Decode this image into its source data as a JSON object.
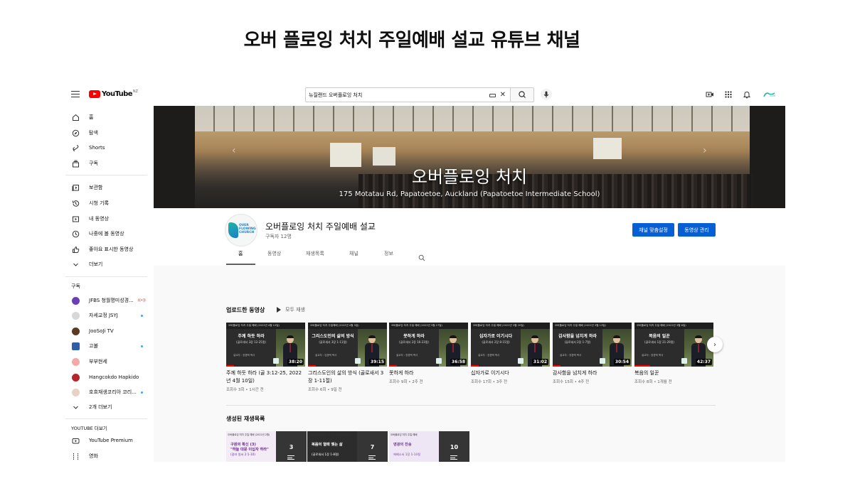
{
  "heading": "오버 플로잉 처치 주일예배 설교 유튜브 채널",
  "topbar": {
    "logo_text": "YouTube",
    "country": "NZ",
    "search_value": "뉴질랜드 오버플로잉 처치",
    "search_icon": "search-icon",
    "mic_icon": "mic-icon",
    "create_icon": "create-video-icon",
    "apps_icon": "apps-grid-icon",
    "bell_icon": "bell-icon",
    "account_icon": "account-avatar-icon"
  },
  "sidebar": {
    "main": [
      {
        "label": "홈",
        "icon": "home-icon"
      },
      {
        "label": "탐색",
        "icon": "compass-icon"
      },
      {
        "label": "Shorts",
        "icon": "shorts-icon"
      },
      {
        "label": "구독",
        "icon": "subscriptions-icon"
      }
    ],
    "library": [
      {
        "label": "보관함",
        "icon": "library-icon"
      },
      {
        "label": "시청 기록",
        "icon": "history-icon"
      },
      {
        "label": "내 동영상",
        "icon": "my-videos-icon"
      },
      {
        "label": "나중에 볼 동영상",
        "icon": "watch-later-icon"
      },
      {
        "label": "좋아요 표시한 동영상",
        "icon": "liked-videos-icon"
      },
      {
        "label": "더보기",
        "icon": "chevron-down-icon"
      }
    ],
    "subscriptions_title": "구독",
    "subscriptions": [
      {
        "label": "JFBS 청월명미성경...",
        "color": "#6a3fb5",
        "badge": "((•))"
      },
      {
        "label": "자세교정 JSYJ",
        "color": "#d7d7d7",
        "badge": "dot"
      },
      {
        "label": "JooSoJi TV",
        "color": "#5b3a22",
        "badge": ""
      },
      {
        "label": "고불",
        "color": "#2f5fa8",
        "badge": "dot"
      },
      {
        "label": "부부현세",
        "color": "#f4a9a8",
        "badge": ""
      },
      {
        "label": "Hangcokdo Hapkido",
        "color": "#b3262d",
        "badge": ""
      },
      {
        "label": "호흐재생코리아 코리...",
        "color": "#e8d2c5",
        "badge": "dot"
      },
      {
        "label": "2개 더보기",
        "color": "",
        "badge": ""
      }
    ],
    "more_title": "YOUTUBE 더보기",
    "more": [
      {
        "label": "YouTube Premium",
        "icon": "youtube-premium-icon"
      },
      {
        "label": "영화",
        "icon": "movies-icon"
      }
    ]
  },
  "banner": {
    "title": "오버플로잉 처치",
    "subtitle": "175 Motatau Rd, Papatoetoe, Auckland (Papatoetoe Intermediate School)"
  },
  "channel": {
    "avatar_lines": [
      "OVER",
      "FLOWING",
      "CHURCH"
    ],
    "name": "오버플로잉 처치 주일예배 설교",
    "subscribers": "구독자 12명",
    "customize_label": "채널 맞춤설정",
    "manage_label": "동영상 관리"
  },
  "tabs": [
    "홈",
    "동영상",
    "재생목록",
    "채널",
    "정보"
  ],
  "uploads": {
    "title": "업로드한 동영상",
    "play_all": "모두 재생",
    "videos": [
      {
        "thumb_header": "오버플로잉 처치 주일 예배 (2022년 4월 10일)",
        "thumb_title": "주께 하듯 하라",
        "thumb_ref": "(골로새서 3장 12-25절)",
        "thumb_foot": "설교자 : 장경택 목사",
        "duration": "38:20",
        "progress": 0.1,
        "title": "주께 하듯 하라 (골 3:12-25, 2022년 4월 10일)",
        "meta": "조회수 3회 • 1시간 전"
      },
      {
        "thumb_header": "오버플로잉 처치 주일예배 (2022년 4월 3일)",
        "thumb_title": "그리스도인의 삶의 방식",
        "thumb_ref": "(골로새서 3장 1-11절)",
        "thumb_foot": "설교자 : 김경택 목사",
        "duration": "39:15",
        "progress": 0.1,
        "title": "그리스도인의 삶의 방식 (골로새서 3장 1-11절)",
        "meta": "조회수 6회 • 9일 전"
      },
      {
        "thumb_header": "오버플로잉 처치 주일 예배 (2022년 3월 27일)",
        "thumb_title": "못하게 하라",
        "thumb_ref": "(골로새서 2장 16-23절)",
        "thumb_foot": "설교자 : 장경택 목사",
        "duration": "36:58",
        "progress": 0.1,
        "title": "못하게 하라",
        "meta": "조회수 9회 • 2주 전"
      },
      {
        "thumb_header": "오버플로잉 처치 주일 예배 (2022년 3월 20일)",
        "thumb_title": "십자가로 이기시다",
        "thumb_ref": "(골로새서 2장 8-15절)",
        "thumb_foot": "설교자 : 장경택 목사",
        "duration": "31:02",
        "progress": 0.1,
        "title": "십자가로 이기시다",
        "meta": "조회수 17회 • 3주 전"
      },
      {
        "thumb_header": "오버플로잉 처치 주일 예배 (2022년 3월 13일)",
        "thumb_title": "감사함을 넘치게 하라",
        "thumb_ref": "(골로새서 2장 1-7절)",
        "thumb_foot": "설교자 : 장경택 목사",
        "duration": "30:54",
        "progress": 0.1,
        "title": "감사함을 넘치게 하라",
        "meta": "조회수 15회 • 4주 전"
      },
      {
        "thumb_header": "오버플로잉 처치 주일 예배 (2022년 3월 6일)",
        "thumb_title": "복음의 일꾼",
        "thumb_ref": "(골로새서 1장 21-29절)",
        "thumb_foot": "설교자 : 장경택 목사",
        "duration": "42:37",
        "progress": 0.2,
        "title": "복음의 일꾼",
        "meta": "조회수 8회 • 1개월 전"
      }
    ]
  },
  "playlists": {
    "title": "생성된 재생목록",
    "items": [
      {
        "header": "오버플로잉 처치 주일 예배 (2022년 2월)",
        "t1": "구원의 확신 (3)\n\"하늘 대문 이십자 하라\"",
        "t2": "(갈라 일서 2:1-10)",
        "count": "3",
        "bg": "#f3ecf7",
        "fg": "#6a2a8c"
      },
      {
        "header": "오버플로잉 처치 주일 예배 (2022년 2월)",
        "t1": "복음의 열매 맺는 삶",
        "t2": "(골로새서 1장 1-8절)",
        "count": "7",
        "bg": "#2c2c2c",
        "fg": "#ffffff"
      },
      {
        "header": "오버플로잉 처치 주일 예배",
        "t1": "영광의 찬송",
        "t2": "에베소서 1장 1-14절",
        "count": "10",
        "bg": "#eee6f4",
        "fg": "#7a3fa0"
      }
    ]
  }
}
